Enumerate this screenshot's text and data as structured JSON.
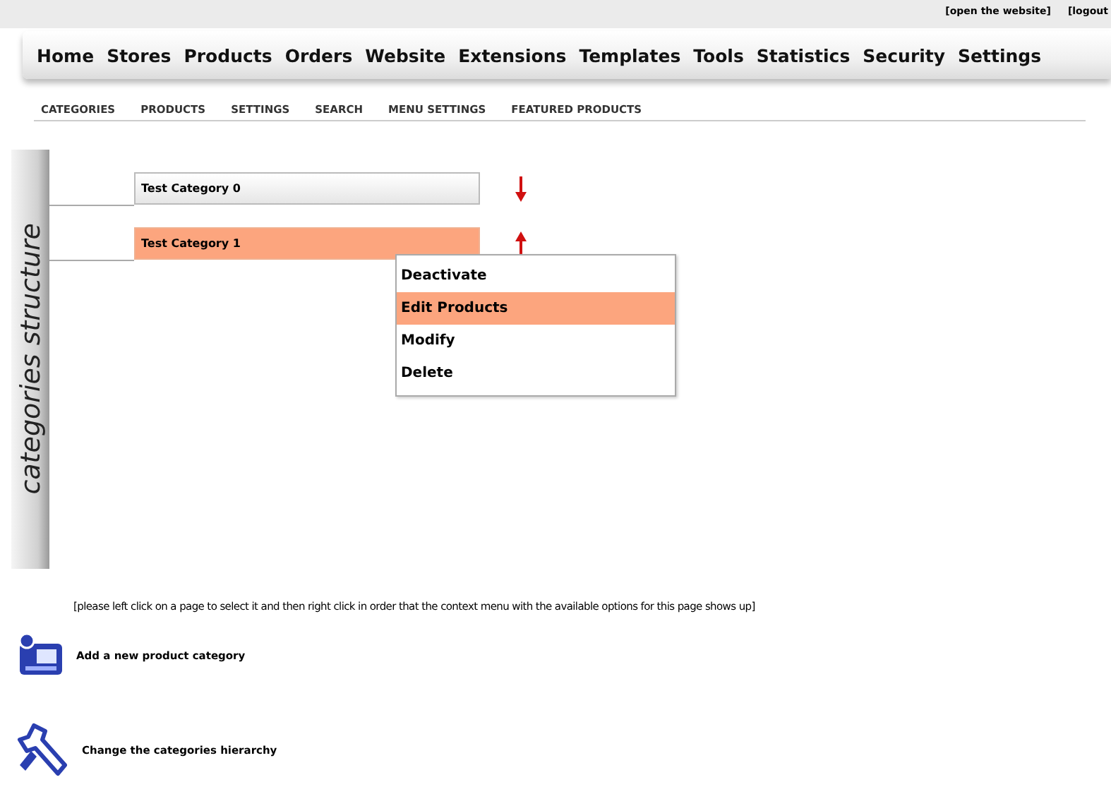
{
  "top_links": [
    "[open the website]",
    "[logout"
  ],
  "main_menu": [
    "Home",
    "Stores",
    "Products",
    "Orders",
    "Website",
    "Extensions",
    "Templates",
    "Tools",
    "Statistics",
    "Security",
    "Settings"
  ],
  "sub_menu": [
    "CATEGORIES",
    "PRODUCTS",
    "SETTINGS",
    "SEARCH",
    "MENU SETTINGS",
    "FEATURED PRODUCTS"
  ],
  "side_label": "categories structure",
  "categories": [
    {
      "name": "Test Category 0",
      "selected": false,
      "kind": "down"
    },
    {
      "name": "Test Category 1",
      "selected": true,
      "kind": "up"
    }
  ],
  "context_menu": [
    {
      "label": "Deactivate",
      "selected": false
    },
    {
      "label": "Edit Products",
      "selected": true
    },
    {
      "label": "Modify",
      "selected": false
    },
    {
      "label": "Delete",
      "selected": false
    }
  ],
  "hint": "[please left click on a page to select it and then right click in order that the context menu with the available options for this page shows up]",
  "actions": [
    {
      "label": "Add a new product category",
      "kind": "add"
    },
    {
      "label": "Change the categories hierarchy",
      "kind": "hierarchy"
    }
  ]
}
